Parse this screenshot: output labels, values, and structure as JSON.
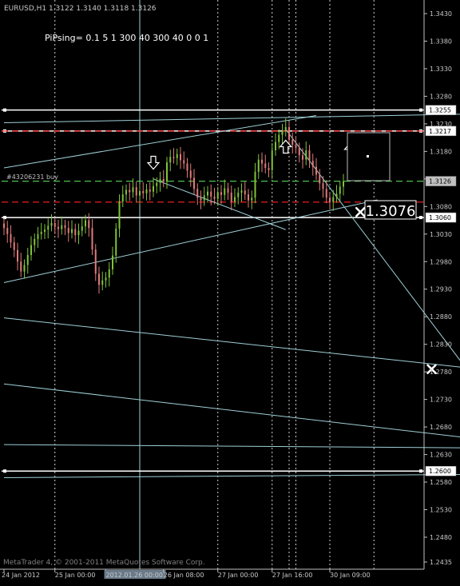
{
  "window": {
    "symbol_line": "EURUSD,H1  1.3122 1.3140 1.3118 1.3126",
    "indicator_label": "PiPsing= 0.1 5 1  300  40  300  40  0  0  1",
    "copyright": "MetaTrader 4, © 2001-2011 MetaQuotes Software Corp.",
    "order_label": "#43206231 buy",
    "big_price": "1.3076",
    "colors": {
      "background": "#000000",
      "bull": "#7fc33a",
      "bear": "#e07a7a",
      "trendline": "#9ecfd6",
      "level": "#ffffff",
      "red_dash": "#ff2222",
      "green_dash": "#4cc24c",
      "grid": "#808080"
    }
  },
  "chart_data": {
    "type": "candlestick",
    "symbol": "EURUSD",
    "timeframe": "H1",
    "ohlc_last": {
      "open": 1.3122,
      "high": 1.314,
      "low": 1.3118,
      "close": 1.3126
    },
    "ylim": [
      1.241,
      1.345
    ],
    "y_ticks": [
      "1.3430",
      "1.3380",
      "1.3330",
      "1.3280",
      "1.3230",
      "1.3180",
      "1.3130",
      "1.3080",
      "1.3030",
      "1.2980",
      "1.2930",
      "1.2880",
      "1.2830",
      "1.2780",
      "1.2730",
      "1.2680",
      "1.2630",
      "1.2580",
      "1.2530",
      "1.2480",
      "1.2435"
    ],
    "y_tick_values": [
      1.343,
      1.338,
      1.333,
      1.328,
      1.323,
      1.318,
      1.313,
      1.308,
      1.303,
      1.298,
      1.293,
      1.288,
      1.283,
      1.278,
      1.273,
      1.268,
      1.263,
      1.258,
      1.253,
      1.248,
      1.2435
    ],
    "x_ticks": [
      "24 Jan 2012",
      "25 Jan 00:00",
      "2012.01.26 00:00",
      "26 Jan 08:00",
      "27 Jan 00:00",
      "27 Jan 16:00",
      "30 Jan 09:00"
    ],
    "x_tick_bars": [
      0,
      15,
      30,
      47,
      63,
      79,
      96
    ],
    "bars_visible": 140,
    "price_tags": [
      {
        "label": "1.3255",
        "value": 1.3255,
        "color": "#ffffff"
      },
      {
        "label": "1.3217",
        "value": 1.3217,
        "color": "#ffffff"
      },
      {
        "label": "1.3126",
        "value": 1.3126,
        "color": "#c0c0c0"
      },
      {
        "label": "1.3060",
        "value": 1.306,
        "color": "#ffffff"
      },
      {
        "label": "1.2600",
        "value": 1.26,
        "color": "#ffffff"
      }
    ],
    "horizontal_levels": [
      {
        "value": 1.3255,
        "style": "solid",
        "color": "#ffffff"
      },
      {
        "value": 1.3217,
        "style": "solid",
        "color": "#ffffff"
      },
      {
        "value": 1.3217,
        "style": "dash",
        "color": "#ff2222"
      },
      {
        "value": 1.3126,
        "style": "dash",
        "color": "#4cc24c"
      },
      {
        "value": 1.3088,
        "style": "dash",
        "color": "#ff2222"
      },
      {
        "value": 1.306,
        "style": "solid",
        "color": "#ffffff"
      },
      {
        "value": 1.26,
        "style": "solid",
        "color": "#ffffff"
      }
    ],
    "trend_lines": [
      {
        "x1": 0,
        "y1": 1.3232,
        "x2": 140,
        "y2": 1.3248
      },
      {
        "x1": 0,
        "y1": 1.315,
        "x2": 92,
        "y2": 1.3245
      },
      {
        "x1": 0,
        "y1": 1.2942,
        "x2": 110,
        "y2": 1.3092
      },
      {
        "x1": 44,
        "y1": 1.313,
        "x2": 83,
        "y2": 1.3038
      },
      {
        "x1": 83,
        "y1": 1.322,
        "x2": 140,
        "y2": 1.2755
      },
      {
        "x1": 0,
        "y1": 1.2878,
        "x2": 140,
        "y2": 1.2785
      },
      {
        "x1": 0,
        "y1": 1.2758,
        "x2": 140,
        "y2": 1.2658
      },
      {
        "x1": 0,
        "y1": 1.2648,
        "x2": 140,
        "y2": 1.2642
      },
      {
        "x1": 0,
        "y1": 1.2588,
        "x2": 140,
        "y2": 1.2594
      }
    ],
    "vertical_lines": [
      {
        "bar": 15,
        "style": "dot"
      },
      {
        "bar": 40,
        "style": "solid"
      },
      {
        "bar": 63,
        "style": "dot"
      },
      {
        "bar": 79,
        "style": "dot"
      },
      {
        "bar": 84,
        "style": "dot"
      },
      {
        "bar": 86,
        "style": "dot"
      },
      {
        "bar": 96,
        "style": "dot"
      },
      {
        "bar": 109,
        "style": "dot"
      }
    ],
    "arrows": [
      {
        "bar": 44,
        "value": 1.3158,
        "dir": "down"
      },
      {
        "bar": 83,
        "value": 1.319,
        "dir": "up"
      },
      {
        "bar": 102,
        "value": 1.3185,
        "dir": "up"
      }
    ],
    "crosses": [
      {
        "bar": 105,
        "value": 1.307
      },
      {
        "bar": 126,
        "value": 1.2785
      }
    ],
    "closes": [
      1.3041,
      1.303,
      1.3015,
      1.3001,
      1.298,
      1.2962,
      1.2974,
      1.2992,
      1.301,
      1.3021,
      1.303,
      1.3034,
      1.3038,
      1.3045,
      1.305,
      1.3043,
      1.3039,
      1.3046,
      1.3041,
      1.3032,
      1.3039,
      1.3028,
      1.3036,
      1.3044,
      1.3055,
      1.3041,
      1.3002,
      1.2958,
      1.2938,
      1.2946,
      1.2951,
      1.2966,
      1.2991,
      1.304,
      1.3089,
      1.3102,
      1.311,
      1.3106,
      1.3115,
      1.31,
      1.3108,
      1.3104,
      1.3111,
      1.3107,
      1.3117,
      1.3123,
      1.313,
      1.3125,
      1.316,
      1.317,
      1.3168,
      1.3175,
      1.3164,
      1.3158,
      1.3145,
      1.3132,
      1.3112,
      1.3096,
      1.3091,
      1.31,
      1.3107,
      1.3098,
      1.3094,
      1.3106,
      1.3101,
      1.3113,
      1.3105,
      1.3089,
      1.3097,
      1.3105,
      1.3109,
      1.3102,
      1.3091,
      1.3096,
      1.3143,
      1.3165,
      1.3158,
      1.315,
      1.3146,
      1.3182,
      1.3197,
      1.321,
      1.3217,
      1.3224,
      1.3201,
      1.3192,
      1.3186,
      1.3173,
      1.3165,
      1.3182,
      1.3163,
      1.3152,
      1.3138,
      1.3122,
      1.3112,
      1.3096,
      1.3088,
      1.3097,
      1.3103,
      1.3116,
      1.3126
    ]
  }
}
